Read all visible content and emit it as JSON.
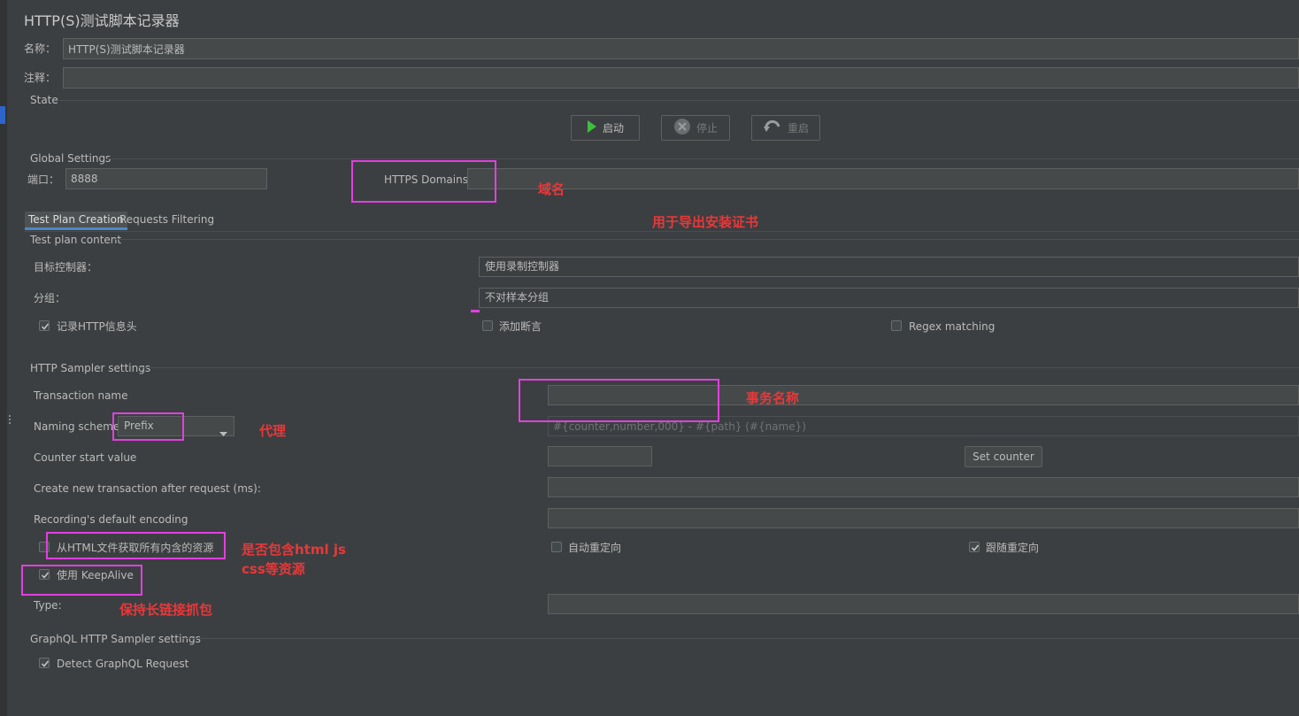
{
  "title": "HTTP(S)测试脚本记录器",
  "name_label": "名称：",
  "name_value": "HTTP(S)测试脚本记录器",
  "comment_label": "注释：",
  "comment_value": "",
  "state": {
    "label": "State",
    "start": "启动",
    "stop": "停止",
    "restart": "重启"
  },
  "global": {
    "label": "Global Settings",
    "port_label": "端口：",
    "port_value": "8888",
    "https_label": "HTTPS Domains:",
    "https_value": ""
  },
  "tabs": [
    "Test Plan Creation",
    "Requests Filtering"
  ],
  "plan": {
    "section": "Test plan content",
    "target_label": "目标控制器：",
    "target_value": "使用录制控制器",
    "group_label": "分组：",
    "group_value": "不对样本分组",
    "record_headers": "记录HTTP信息头",
    "add_assertions": "添加断言",
    "regex_matching": "Regex matching"
  },
  "sampler": {
    "section": "HTTP Sampler settings",
    "transaction_label": "Transaction name",
    "transaction_value": "",
    "naming_label": "Naming scheme",
    "naming_value": "Prefix",
    "naming_placeholder": "#{counter,number,000} - #{path} (#{name})",
    "counter_label": "Counter start value",
    "counter_value": "",
    "set_counter": "Set counter",
    "create_tx_label": "Create new transaction after request (ms):",
    "create_tx_value": "",
    "encoding_label": "Recording's default encoding",
    "encoding_value": "",
    "retrieve_resources": "从HTML文件获取所有内含的资源",
    "auto_redirect": "自动重定向",
    "follow_redirect": "跟随重定向",
    "keepalive": "使用 KeepAlive",
    "type_label": "Type:",
    "type_value": ""
  },
  "graphql": {
    "section": "GraphQL HTTP Sampler settings",
    "detect": "Detect GraphQL Request"
  },
  "annotations": {
    "domain": "域名",
    "cert": "用于导出安装证书",
    "tx_name": "事务名称",
    "proxy": "代理",
    "html_line1": "是否包含html js",
    "html_line2": "css等资源",
    "keepalive": "保持长链接抓包"
  },
  "colors": {
    "background": "#3c3f41",
    "field": "#45494a",
    "annotation_box": "#e040e0",
    "annotation_text": "#e8383a",
    "tab_accent": "#4a88c7"
  }
}
